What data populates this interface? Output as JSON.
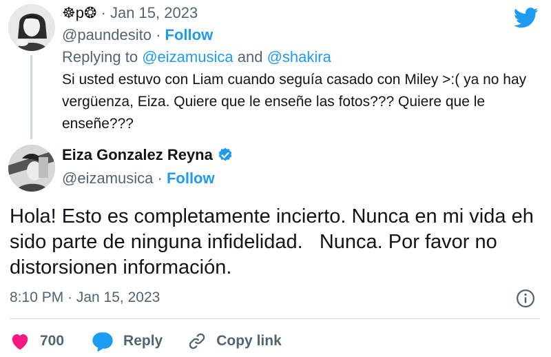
{
  "reply_tweet": {
    "display_name": "☸p❂",
    "date": "Jan 15, 2023",
    "handle": "@paundesito",
    "follow_label": "Follow",
    "replying_to_prefix": "Replying to",
    "replying_to_user1": "@eizamusica",
    "replying_to_and": "and",
    "replying_to_user2": "@shakira",
    "text": "Si usted estuvo con Liam cuando seguía casado con Miley >:( ya no hay vergüenza, Eiza. Quiere que le enseñe las fotos??? Quiere que le enseñe???"
  },
  "main_tweet": {
    "display_name": "Eiza Gonzalez Reyna",
    "handle": "@eizamusica",
    "follow_label": "Follow",
    "text": "Hola! Esto es completamente incierto. Nunca en mi vida eh sido parte de ninguna infidelidad.   Nunca. Por favor no distorsionen información.",
    "timestamp": "8:10 PM · Jan 15, 2023"
  },
  "actions": {
    "like_count": "700",
    "reply_label": "Reply",
    "copy_link_label": "Copy link"
  },
  "colors": {
    "accent": "#1d9bf0",
    "like": "#f91880",
    "muted": "#536471"
  },
  "icons": [
    "twitter-logo-icon",
    "verified-badge-icon",
    "info-icon",
    "heart-icon",
    "reply-bubble-icon",
    "link-icon"
  ]
}
